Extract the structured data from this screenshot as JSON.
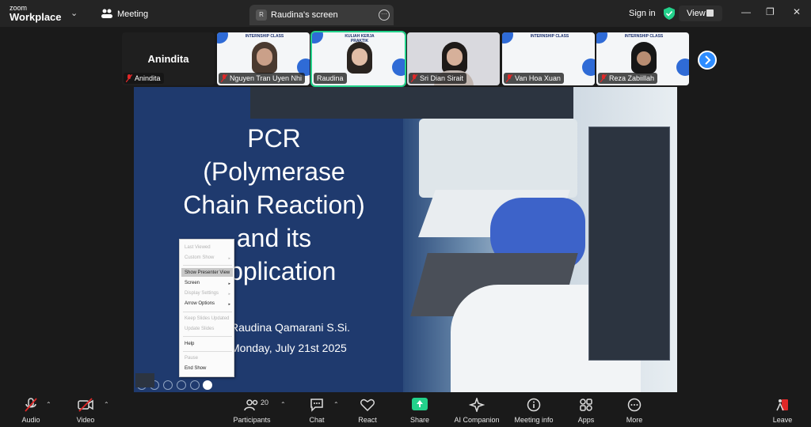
{
  "app": {
    "brand_small": "zoom",
    "brand_big": "Workplace",
    "meeting_label": "Meeting"
  },
  "screen_tab": {
    "avatar_letter": "R",
    "title": "Raudina's screen"
  },
  "topbar": {
    "sign_in": "Sign in",
    "view": "View"
  },
  "participants_strip": [
    {
      "name": "Anindita",
      "big_name": "Anindita",
      "video": false
    },
    {
      "name": "Nguyen Tran Uyen Nhi",
      "header": "INTERNSHIP CLASS",
      "video": true
    },
    {
      "name": "Raudina",
      "header": "KULIAH KERJA PRAKTIK",
      "video": true,
      "active": true
    },
    {
      "name": "Sri Dian Sirait",
      "header": "",
      "video": true
    },
    {
      "name": "Van Hoa Xuan",
      "header": "INTERNSHIP CLASS",
      "video": true
    },
    {
      "name": "Reza Zabiillah",
      "header": "INTERNSHIP CLASS",
      "video": true
    }
  ],
  "slide": {
    "title_lines": [
      "PCR",
      "(Polymerase",
      "Chain Reaction)",
      "and its",
      "Application"
    ],
    "presenter": "Raudina Qamarani S.Si.",
    "date": "Monday, July 21st 2025"
  },
  "context_menu": {
    "items": [
      {
        "label": "Last Viewed",
        "enabled": false,
        "submenu": false
      },
      {
        "label": "Custom Show",
        "enabled": false,
        "submenu": true
      },
      {
        "label": "Show Presenter View",
        "enabled": true,
        "submenu": false,
        "highlighted": true
      },
      {
        "label": "Screen",
        "enabled": true,
        "submenu": true
      },
      {
        "label": "Display Settings",
        "enabled": false,
        "submenu": true
      },
      {
        "label": "Arrow Options",
        "enabled": true,
        "submenu": true
      },
      {
        "label": "Keep Slides Updated",
        "enabled": false,
        "submenu": false
      },
      {
        "label": "Update Slides",
        "enabled": false,
        "submenu": false
      },
      {
        "label": "Help",
        "enabled": true,
        "submenu": false
      },
      {
        "label": "Pause",
        "enabled": false,
        "submenu": false
      },
      {
        "label": "End Show",
        "enabled": true,
        "submenu": false
      }
    ]
  },
  "toolbar": {
    "audio": "Audio",
    "video": "Video",
    "participants": "Participants",
    "participants_count": "20",
    "chat": "Chat",
    "react": "React",
    "share": "Share",
    "ai_companion": "AI Companion",
    "meeting_info": "Meeting info",
    "apps": "Apps",
    "more": "More",
    "leave": "Leave"
  },
  "colors": {
    "accent_green": "#23d18b",
    "muted_red": "#e02828",
    "slide_blue": "#1f3a6e",
    "next_blue": "#2d8cff"
  }
}
